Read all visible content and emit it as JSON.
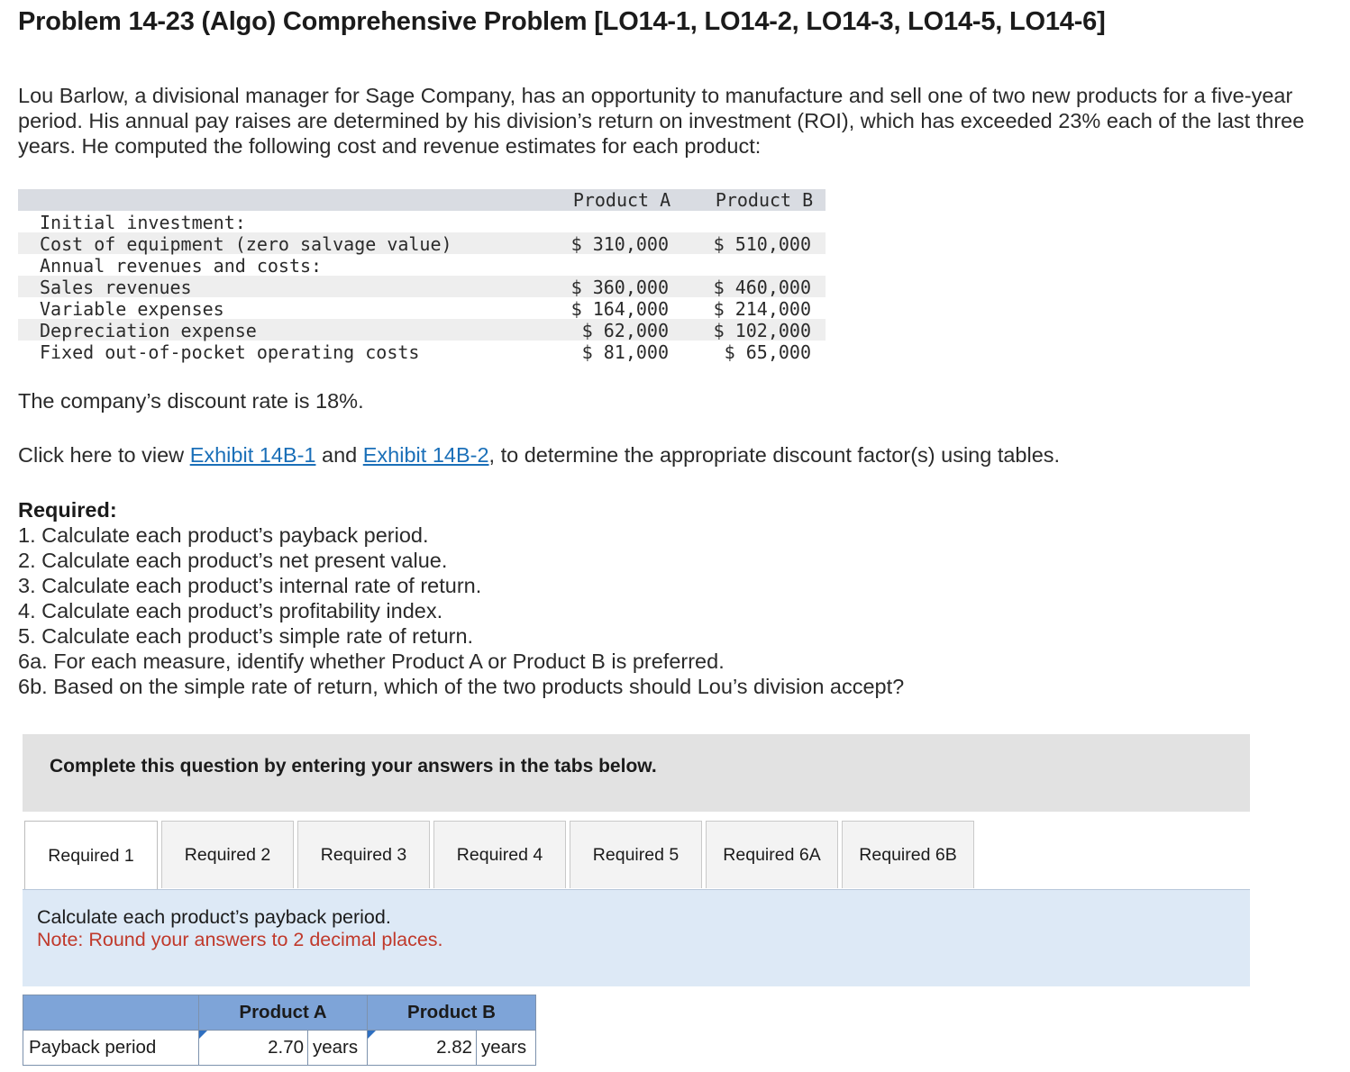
{
  "title": "Problem 14-23 (Algo) Comprehensive Problem [LO14-1, LO14-2, LO14-3, LO14-5, LO14-6]",
  "intro": "Lou Barlow, a divisional manager for Sage Company, has an opportunity to manufacture and sell one of two new products for a five-year period. His annual pay raises are determined by his division’s return on investment (ROI), which has exceeded 23% each of the last three years. He computed the following cost and revenue estimates for each product:",
  "data_table": {
    "col_a": "Product A",
    "col_b": "Product B",
    "rows": [
      {
        "label": "Initial investment:",
        "a": "",
        "b": ""
      },
      {
        "label": "Cost of equipment (zero salvage value)",
        "a": "$ 310,000",
        "b": "$ 510,000"
      },
      {
        "label": "Annual revenues and costs:",
        "a": "",
        "b": ""
      },
      {
        "label": "Sales revenues",
        "a": "$ 360,000",
        "b": "$ 460,000"
      },
      {
        "label": "Variable expenses",
        "a": "$ 164,000",
        "b": "$ 214,000"
      },
      {
        "label": "Depreciation expense",
        "a": "$ 62,000",
        "b": "$ 102,000"
      },
      {
        "label": "Fixed out-of-pocket operating costs",
        "a": "$ 81,000",
        "b": "$ 65,000"
      }
    ]
  },
  "discount_text": "The company’s discount rate is 18%.",
  "exhibit": {
    "prefix": "Click here to view ",
    "link1": "Exhibit 14B-1",
    "middle": " and ",
    "link2": "Exhibit 14B-2",
    "suffix": ", to determine the appropriate discount factor(s) using tables."
  },
  "required": {
    "heading": "Required:",
    "items": [
      "1. Calculate each product’s payback period.",
      "2. Calculate each product’s net present value.",
      "3. Calculate each product’s internal rate of return.",
      "4. Calculate each product’s profitability index.",
      "5. Calculate each product’s simple rate of return.",
      "6a. For each measure, identify whether Product A or Product B is preferred.",
      "6b. Based on the simple rate of return, which of the two products should Lou’s division accept?"
    ]
  },
  "banner": "Complete this question by entering your answers in the tabs below.",
  "tabs": [
    {
      "label": "Required 1",
      "active": true
    },
    {
      "label": "Required 2",
      "active": false
    },
    {
      "label": "Required 3",
      "active": false
    },
    {
      "label": "Required 4",
      "active": false
    },
    {
      "label": "Required 5",
      "active": false
    },
    {
      "label": "Required 6A",
      "active": false
    },
    {
      "label": "Required 6B",
      "active": false
    }
  ],
  "panel": {
    "instruction": "Calculate each product’s payback period.",
    "note": "Note: Round your answers to 2 decimal places."
  },
  "answer_table": {
    "col_a": "Product A",
    "col_b": "Product B",
    "row_label": "Payback period",
    "a_value": "2.70",
    "a_unit": "years",
    "b_value": "2.82",
    "b_unit": "years"
  }
}
